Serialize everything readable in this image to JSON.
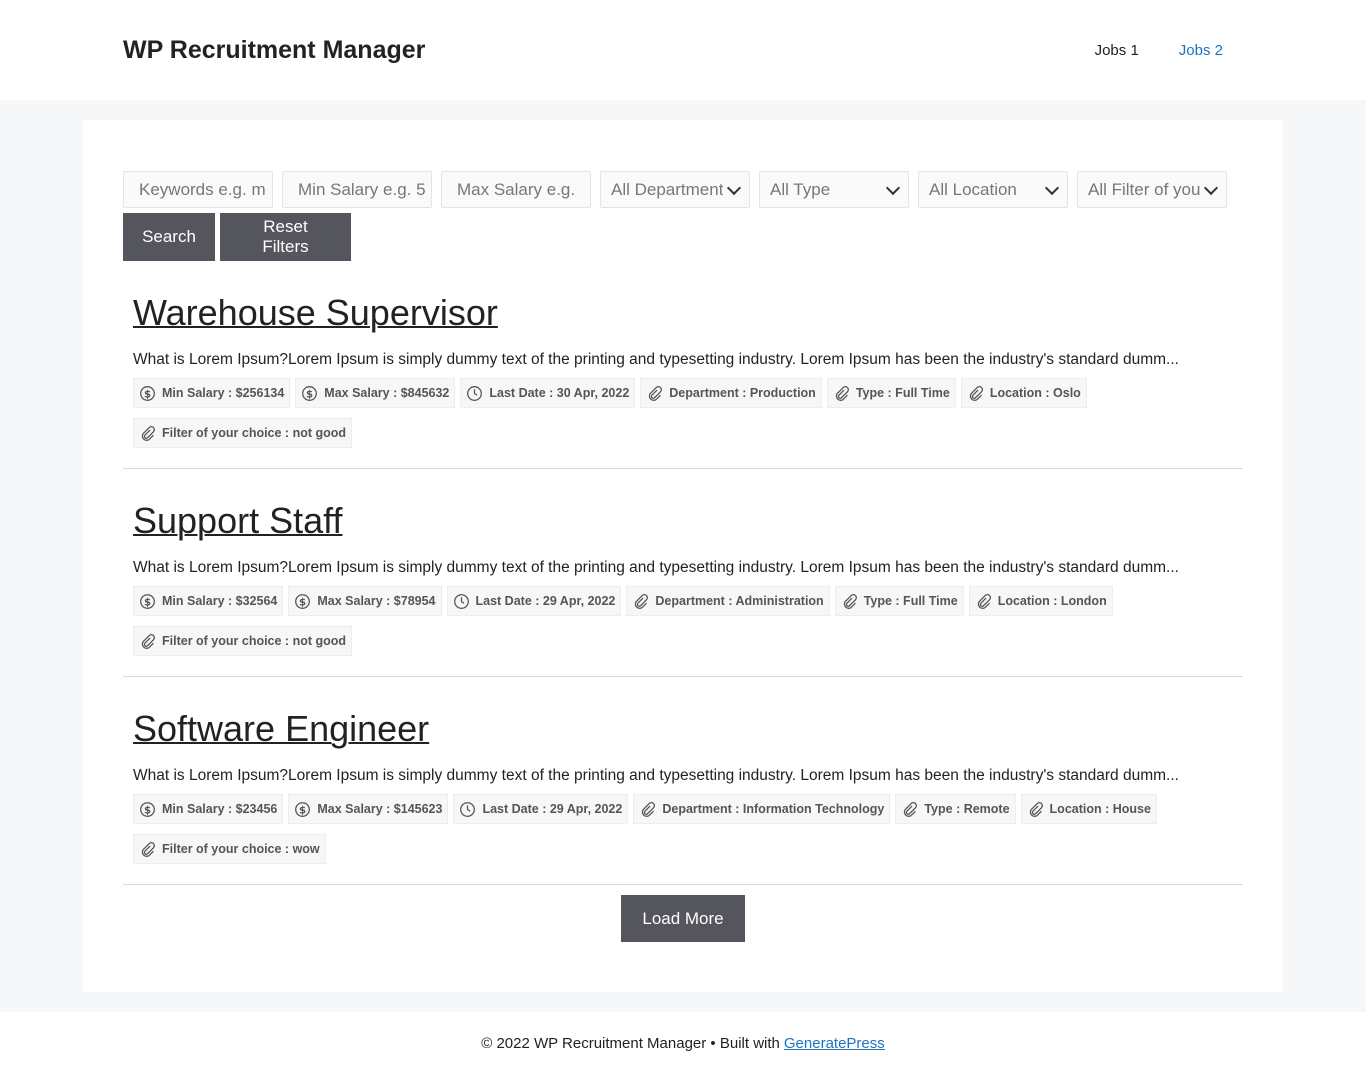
{
  "header": {
    "site_title": "WP Recruitment Manager",
    "nav": [
      {
        "label": "Jobs 1"
      },
      {
        "label": "Jobs 2"
      }
    ]
  },
  "filters": {
    "keywords_placeholder": "Keywords e.g. m",
    "min_salary_placeholder": "Min Salary e.g. 5",
    "max_salary_placeholder": "Max Salary e.g.",
    "department": "All Department",
    "type": "All Type",
    "location": "All Location",
    "custom": "All Filter of your",
    "search_label": "Search",
    "reset_label": "Reset Filters"
  },
  "jobs": [
    {
      "title": "Warehouse Supervisor",
      "description": "What is Lorem Ipsum?Lorem Ipsum is simply dummy text of the printing and typesetting industry. Lorem Ipsum has been the industry's standard dumm...",
      "min_salary": "Min Salary : $256134",
      "max_salary": "Max Salary : $845632",
      "last_date": "Last Date : 30 Apr, 2022",
      "department": "Department : Production",
      "type": "Type : Full Time",
      "location": "Location : Oslo",
      "filter": "Filter of your choice : not good"
    },
    {
      "title": "Support Staff",
      "description": "What is Lorem Ipsum?Lorem Ipsum is simply dummy text of the printing and typesetting industry. Lorem Ipsum has been the industry's standard dumm...",
      "min_salary": "Min Salary : $32564",
      "max_salary": "Max Salary : $78954",
      "last_date": "Last Date : 29 Apr, 2022",
      "department": "Department : Administration",
      "type": "Type : Full Time",
      "location": "Location : London",
      "filter": "Filter of your choice : not good"
    },
    {
      "title": "Software Engineer",
      "description": "What is Lorem Ipsum?Lorem Ipsum is simply dummy text of the printing and typesetting industry. Lorem Ipsum has been the industry's standard dumm...",
      "min_salary": "Min Salary : $23456",
      "max_salary": "Max Salary : $145623",
      "last_date": "Last Date : 29 Apr, 2022",
      "department": "Department : Information Technology",
      "type": "Type : Remote",
      "location": "Location : House",
      "filter": "Filter of your choice : wow"
    }
  ],
  "load_more_label": "Load More",
  "footer": {
    "text": "© 2022 WP Recruitment Manager • Built with",
    "link": "GeneratePress"
  },
  "icons": {
    "salary": "dollar-circle-icon",
    "date": "clock-icon",
    "meta": "paperclip-icon"
  },
  "colors": {
    "button_bg": "#55555e",
    "link": "#1e73be"
  }
}
